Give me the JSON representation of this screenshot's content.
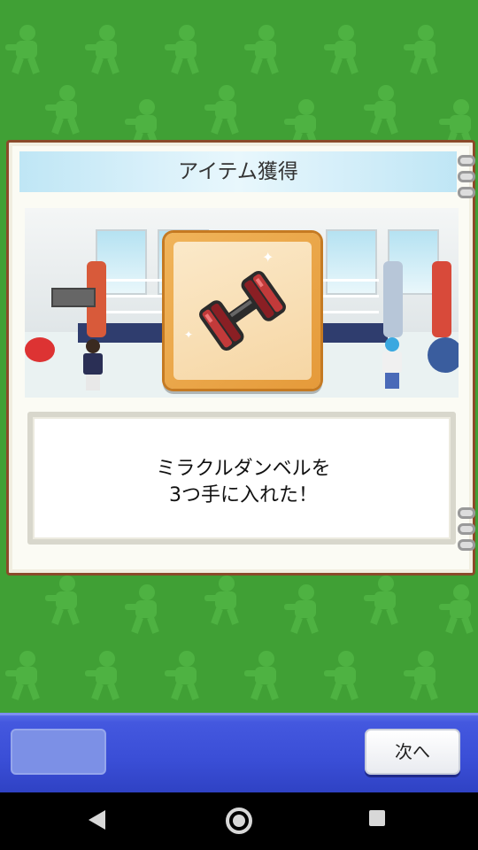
{
  "dialog": {
    "title": "アイテム獲得",
    "message_line1": "ミラクルダンベルを",
    "message_line2": "3つ手に入れた！"
  },
  "item": {
    "icon": "dumbbell-icon"
  },
  "bottom_bar": {
    "next_label": "次へ"
  },
  "nav": {
    "back_icon": "back-triangle-icon",
    "home_icon": "home-circle-icon",
    "recent_icon": "recent-apps-square-icon"
  },
  "colors": {
    "background_green": "#40a035",
    "panel_border": "#8a4a2a",
    "title_bar": "#cdeaf6",
    "item_box": "#e9a448",
    "bottom_bar": "#3a4ed6"
  }
}
